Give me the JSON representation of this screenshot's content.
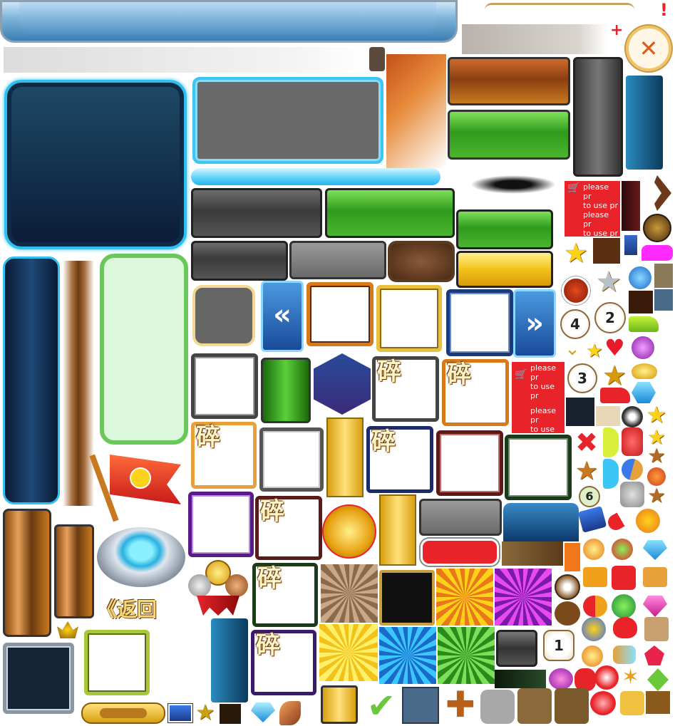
{
  "sheet": {
    "title_bar_label": "",
    "alert_glyph": "!",
    "plus_glyph": "+",
    "close_glyph": "✕",
    "fragment_glyph": "碎",
    "back_label": "《返回",
    "prev_glyph": "«",
    "next_glyph": "»",
    "check_glyph": "✔",
    "big_plus_glyph": "✚",
    "cart_lines": [
      "please pr",
      "to use pr"
    ],
    "numbers": [
      "4",
      "2",
      "3",
      "6",
      "1"
    ],
    "colors": {
      "cyan": "#27b8f0",
      "green": "#3fae2a",
      "gold": "#f2c21a",
      "red": "#e8242a",
      "navy": "#0c2340",
      "brown": "#6b3a12"
    }
  }
}
